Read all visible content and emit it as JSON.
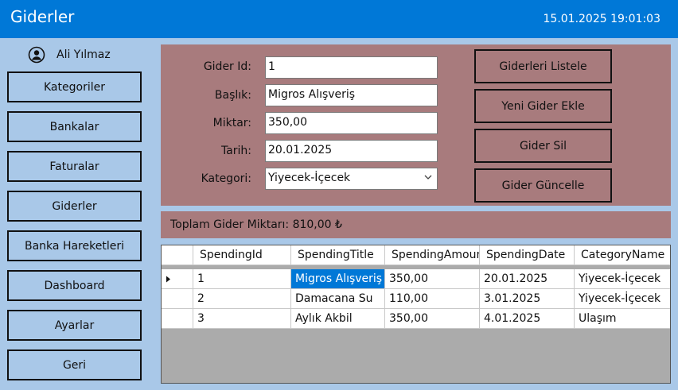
{
  "window": {
    "title": "Giderler",
    "datetime": "15.01.2025 19:01:03"
  },
  "user": {
    "name": "Ali Yılmaz",
    "icon": "user-circle-icon"
  },
  "sidebar": {
    "items": [
      {
        "label": "Kategoriler"
      },
      {
        "label": "Bankalar"
      },
      {
        "label": "Faturalar"
      },
      {
        "label": "Giderler"
      },
      {
        "label": "Banka Hareketleri"
      },
      {
        "label": "Dashboard"
      },
      {
        "label": "Ayarlar"
      },
      {
        "label": "Geri"
      }
    ]
  },
  "form": {
    "id": {
      "label": "Gider Id:",
      "value": "1"
    },
    "title": {
      "label": "Başlık:",
      "value": "Migros Alışveriş"
    },
    "amount": {
      "label": "Miktar:",
      "value": "350,00"
    },
    "date": {
      "label": "Tarih:",
      "value": "20.01.2025"
    },
    "category": {
      "label": "Kategori:",
      "value": "Yiyecek-İçecek"
    }
  },
  "actions": {
    "list": "Giderleri Listele",
    "add": "Yeni Gider Ekle",
    "delete": "Gider Sil",
    "update": "Gider Güncelle"
  },
  "total": {
    "text": "Toplam Gider Miktarı: 810,00 ₺"
  },
  "table": {
    "columns": [
      "SpendingId",
      "SpendingTitle",
      "SpendingAmount",
      "SpendingDate",
      "CategoryName"
    ],
    "rows": [
      [
        "1",
        "Migros Alışveriş",
        "350,00",
        "20.01.2025",
        "Yiyecek-İçecek"
      ],
      [
        "2",
        "Damacana Su",
        "110,00",
        "3.01.2025",
        "Yiyecek-İçecek"
      ],
      [
        "3",
        "Aylık Akbil",
        "350,00",
        "4.01.2025",
        "Ulaşım"
      ]
    ],
    "selected_row": 0,
    "selected_col": 1
  },
  "colors": {
    "titlebar": "#0078d7",
    "background": "#a9c8e8",
    "panel": "#a87b7d",
    "selection": "#0078d7",
    "grid_empty": "#ababab"
  }
}
